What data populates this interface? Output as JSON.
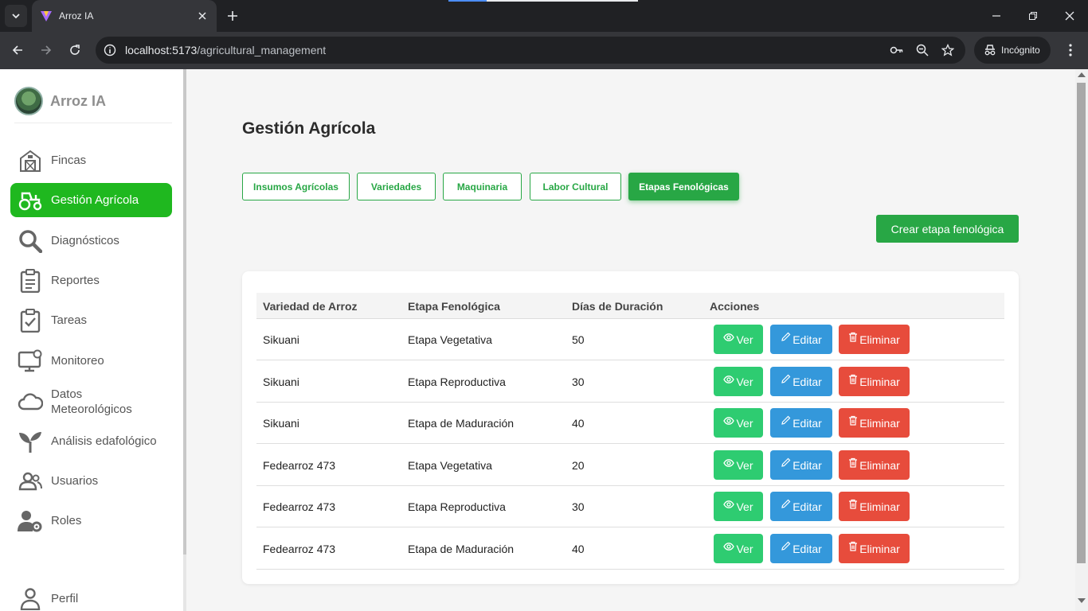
{
  "browser": {
    "tab_title": "Arroz IA",
    "url_host": "localhost:5173",
    "url_path": "/agricultural_management",
    "incognito_label": "Incógnito"
  },
  "sidebar": {
    "brand": "Arroz IA",
    "items": [
      {
        "label": "Fincas",
        "icon": "barn-icon"
      },
      {
        "label": "Gestión Agrícola",
        "icon": "tractor-icon"
      },
      {
        "label": "Diagnósticos",
        "icon": "search-icon"
      },
      {
        "label": "Reportes",
        "icon": "clipboard-icon"
      },
      {
        "label": "Tareas",
        "icon": "clipboard-check-icon"
      },
      {
        "label": "Monitoreo",
        "icon": "monitor-icon"
      },
      {
        "label": "Datos Meteorológicos",
        "icon": "cloud-icon"
      },
      {
        "label": "Análisis edafológico",
        "icon": "seedling-icon"
      },
      {
        "label": "Usuarios",
        "icon": "users-icon"
      },
      {
        "label": "Roles",
        "icon": "user-gear-icon"
      },
      {
        "label": "Perfil",
        "icon": "user-icon"
      }
    ],
    "active_item": "Gestión Agrícola"
  },
  "main": {
    "title": "Gestión Agrícola",
    "tabs": [
      {
        "label": "Insumos Agrícolas",
        "active": false
      },
      {
        "label": "Variedades",
        "active": false
      },
      {
        "label": "Maquinaria",
        "active": false
      },
      {
        "label": "Labor Cultural",
        "active": false
      },
      {
        "label": "Etapas Fenológicas",
        "active": true
      }
    ],
    "create_button": "Crear etapa fenológica",
    "table": {
      "headers": [
        "Variedad de Arroz",
        "Etapa Fenológica",
        "Días de Duración",
        "Acciones"
      ],
      "rows": [
        {
          "variedad": "Sikuani",
          "etapa": "Etapa Vegetativa",
          "dias": "50"
        },
        {
          "variedad": "Sikuani",
          "etapa": "Etapa Reproductiva",
          "dias": "30"
        },
        {
          "variedad": "Sikuani",
          "etapa": "Etapa de Maduración",
          "dias": "40"
        },
        {
          "variedad": "Fedearroz 473",
          "etapa": "Etapa Vegetativa",
          "dias": "20"
        },
        {
          "variedad": "Fedearroz 473",
          "etapa": "Etapa Reproductiva",
          "dias": "30"
        },
        {
          "variedad": "Fedearroz 473",
          "etapa": "Etapa de Maduración",
          "dias": "40"
        }
      ],
      "actions": {
        "view": "Ver",
        "edit": "Editar",
        "delete": "Eliminar"
      }
    }
  },
  "colors": {
    "accent_green": "#28a745",
    "sidebar_active": "#1fb81f",
    "view": "#2ecc71",
    "edit": "#3498db",
    "delete": "#e74c3c"
  }
}
